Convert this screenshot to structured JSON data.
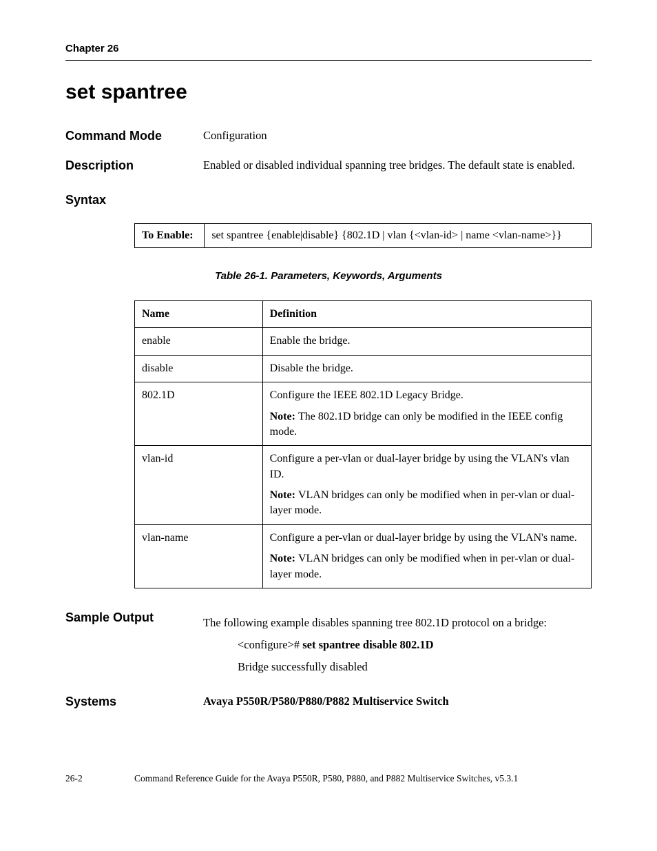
{
  "header": {
    "chapter": "Chapter 26"
  },
  "title": "set spantree",
  "command_mode": {
    "label": "Command Mode",
    "value": "Configuration"
  },
  "description": {
    "label": "Description",
    "value": "Enabled or disabled individual spanning tree bridges. The default state is enabled."
  },
  "syntax": {
    "label": "Syntax",
    "row_label": "To Enable:",
    "row_value": "set spantree {enable|disable} {802.1D | vlan {<vlan-id> | name <vlan-name>}}"
  },
  "table_caption": "Table 26-1.  Parameters, Keywords, Arguments",
  "params_headers": {
    "name": "Name",
    "definition": "Definition"
  },
  "params": [
    {
      "name": "enable",
      "definition": "Enable the bridge.",
      "note": ""
    },
    {
      "name": "disable",
      "definition": "Disable the bridge.",
      "note": ""
    },
    {
      "name": "802.1D",
      "definition": "Configure the IEEE 802.1D Legacy Bridge.",
      "note": "The 802.1D bridge can only be modified in the IEEE config mode."
    },
    {
      "name": "vlan-id",
      "definition": "Configure a per-vlan or dual-layer bridge by using the VLAN's vlan ID.",
      "note": "VLAN bridges can only be modified when in per-vlan or dual-layer mode."
    },
    {
      "name": "vlan-name",
      "definition": "Configure a per-vlan or dual-layer bridge by using the VLAN's name.",
      "note": "VLAN bridges can only be modified when in per-vlan or dual-layer mode."
    }
  ],
  "note_label": "Note:",
  "sample_output": {
    "label": "Sample Output",
    "intro": "The following example disables spanning tree 802.1D protocol on a bridge:",
    "prompt": "<configure># ",
    "command": "set spantree disable 802.1D",
    "result": "Bridge successfully disabled"
  },
  "systems": {
    "label": "Systems",
    "value": "Avaya P550R/P580/P880/P882 Multiservice Switch"
  },
  "footer": {
    "page": "26-2",
    "text": "Command Reference Guide for the Avaya P550R, P580, P880, and P882 Multiservice Switches, v5.3.1"
  }
}
